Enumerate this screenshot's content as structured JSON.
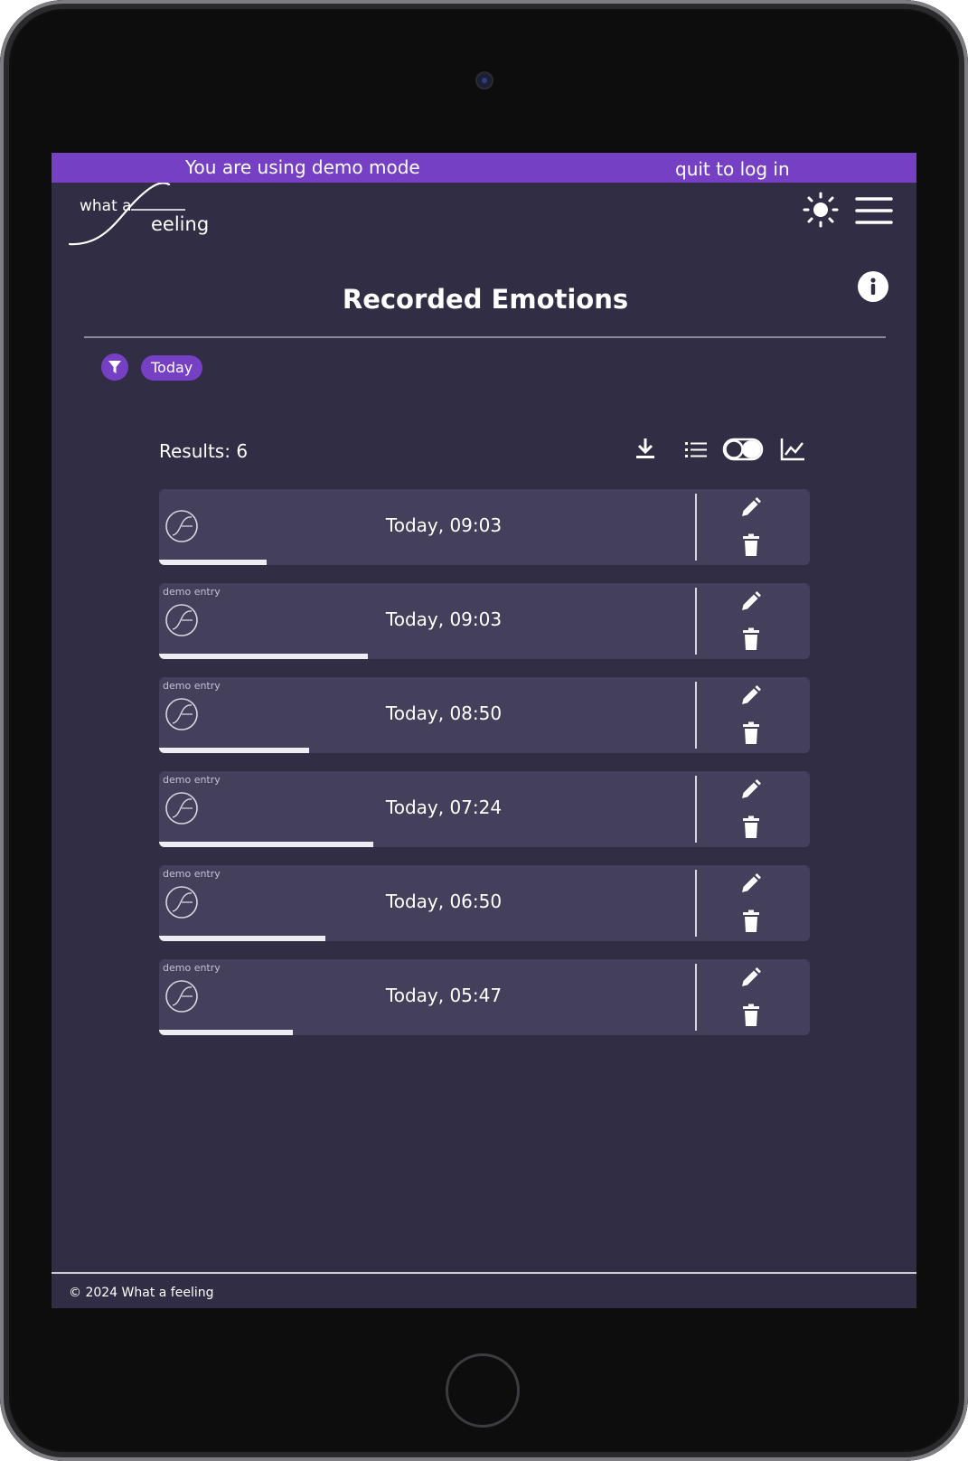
{
  "banner": {
    "text": "You are using demo mode",
    "quit_label": "quit to log in",
    "color": "#7540c4"
  },
  "logo": {
    "line1": "what a",
    "line2": "eeling"
  },
  "header": {
    "theme_icon": "sun-icon",
    "menu_icon": "hamburger-menu-icon"
  },
  "page": {
    "title": "Recorded Emotions",
    "info_icon": "info-icon"
  },
  "filter": {
    "icon": "filter-icon",
    "chip_label": "Today"
  },
  "results": {
    "label": "Results: 6",
    "tools": [
      "download-icon",
      "list-view-icon",
      "view-toggle",
      "line-chart-icon"
    ]
  },
  "entries": [
    {
      "badge": "",
      "time": "Today, 09:03",
      "level": 0.2
    },
    {
      "badge": "demo entry",
      "time": "Today, 09:03",
      "level": 0.39
    },
    {
      "badge": "demo entry",
      "time": "Today, 08:50",
      "level": 0.28
    },
    {
      "badge": "demo entry",
      "time": "Today, 07:24",
      "level": 0.4
    },
    {
      "badge": "demo entry",
      "time": "Today, 06:50",
      "level": 0.31
    },
    {
      "badge": "demo entry",
      "time": "Today, 05:47",
      "level": 0.25
    }
  ],
  "footer": {
    "text": "© 2024 What a feeling"
  },
  "colors": {
    "screen_bg": "#312d45",
    "card_bg": "#443f5b",
    "accent": "#7540c4"
  }
}
